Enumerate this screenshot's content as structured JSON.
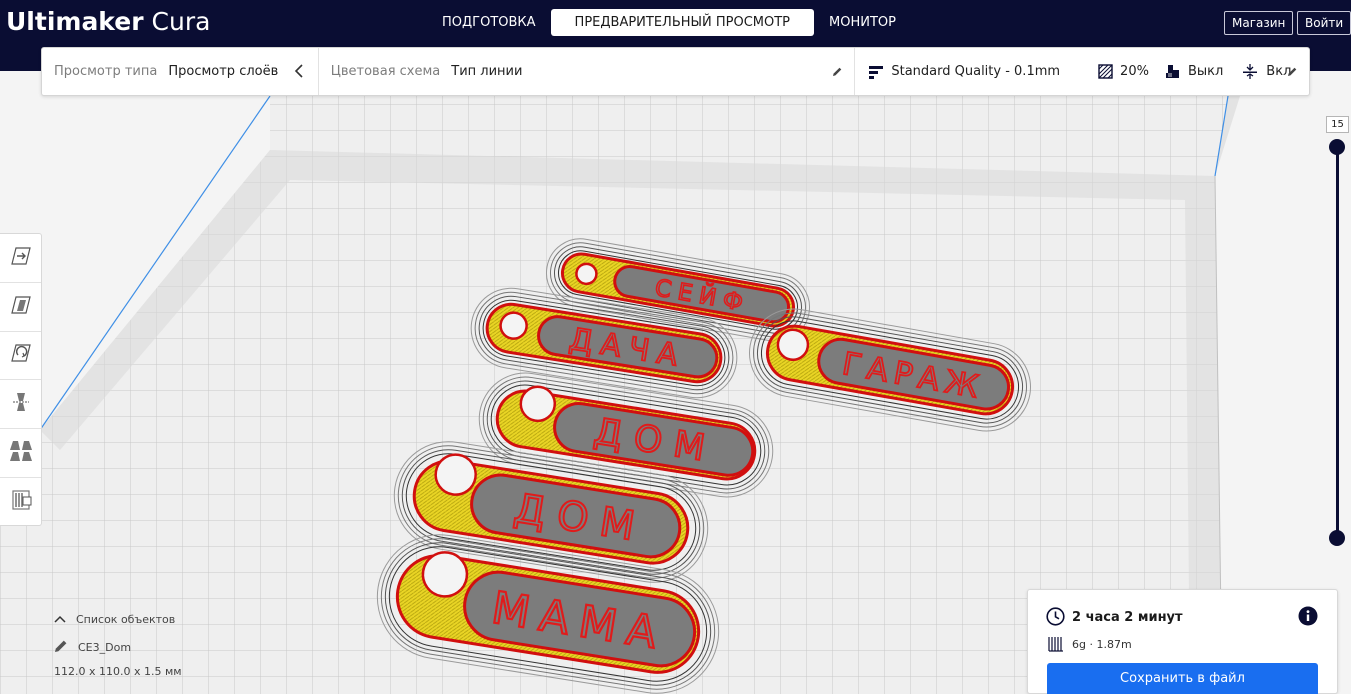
{
  "app": {
    "title_bold": "Ultimaker",
    "title_light": "Cura"
  },
  "stages": [
    {
      "label": "ПОДГОТОВКА",
      "active": false
    },
    {
      "label": "ПРЕДВАРИТЕЛЬНЫЙ ПРОСМОТР",
      "active": true
    },
    {
      "label": "МОНИТОР",
      "active": false
    }
  ],
  "header_buttons": {
    "marketplace": "Магазин",
    "signin": "Войти"
  },
  "view_panel": {
    "view_type_label": "Просмотр типа",
    "view_type_value": "Просмотр слоёв",
    "color_scheme_label": "Цветовая схема",
    "color_scheme_value": "Тип линии",
    "quality": "Standard Quality - 0.1mm",
    "infill": "20%",
    "support": "Выкл",
    "adhesion": "Вкл"
  },
  "layer_slider": {
    "current_layer": "15"
  },
  "models": [
    {
      "text": "СЕЙФ"
    },
    {
      "text": "ДАЧА"
    },
    {
      "text": "ГАРАЖ"
    },
    {
      "text": "ДОМ"
    },
    {
      "text": "ДОМ"
    },
    {
      "text": "МАМА"
    }
  ],
  "object_list": {
    "toggle_label": "Список объектов",
    "object_name": "CE3_Dom",
    "dimensions": "112.0 x 110.0 x 1.5 мм"
  },
  "print_info": {
    "time": "2 часа 2 минут",
    "material": "6g · 1.87m",
    "save_label": "Сохранить в файл"
  },
  "colors": {
    "topbar": "#0a0d33",
    "accent_blue": "#196ef0",
    "wall_red": "#e01b1b",
    "infill_yellow": "#e6d426",
    "skin_gray": "#7c7c7c"
  }
}
